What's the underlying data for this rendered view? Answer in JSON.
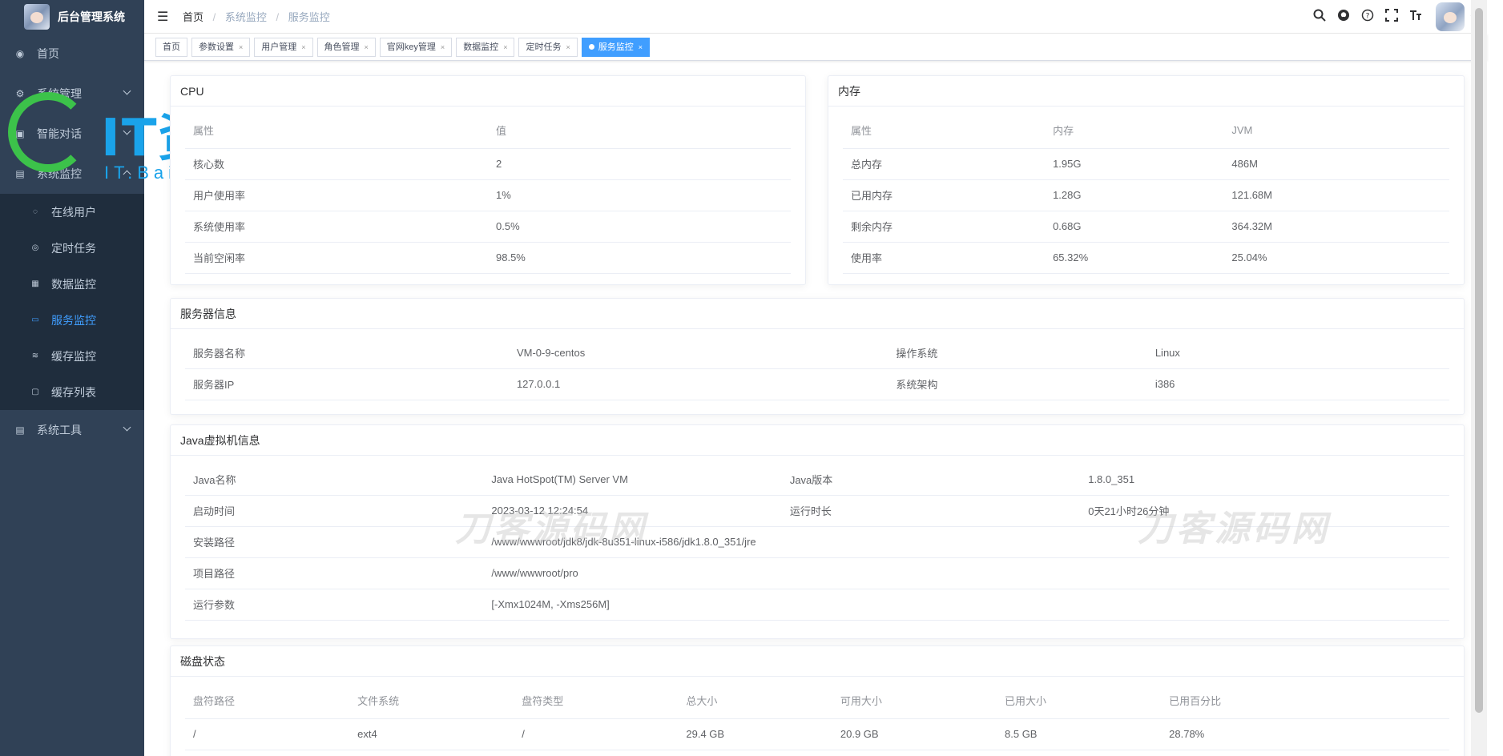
{
  "sidebar": {
    "app_title": "后台管理系统",
    "items": [
      {
        "label": "首页",
        "icon": "dashboard-icon"
      },
      {
        "label": "系统管理",
        "icon": "gear-icon"
      },
      {
        "label": "智能对话",
        "icon": "chat-icon"
      },
      {
        "label": "系统监控",
        "icon": "monitor-icon"
      }
    ],
    "sub_items": [
      {
        "label": "在线用户",
        "icon": "online-icon"
      },
      {
        "label": "定时任务",
        "icon": "job-icon"
      },
      {
        "label": "数据监控",
        "icon": "druid-icon"
      },
      {
        "label": "服务监控",
        "icon": "server-icon"
      },
      {
        "label": "缓存监控",
        "icon": "redis-icon"
      },
      {
        "label": "缓存列表",
        "icon": "redis-list-icon"
      }
    ],
    "tools": {
      "label": "系统工具",
      "icon": "tool-icon"
    }
  },
  "watermarks": {
    "logo_text": "IT资源网",
    "logo_sub": "IT.BaiDu.com",
    "dao_text": "刀客源码网"
  },
  "navbar": {
    "breadcrumb": [
      "首页",
      "系统监控",
      "服务监控"
    ],
    "icons": [
      "search-icon",
      "github-icon",
      "question-icon",
      "fullscreen-icon",
      "font-size-icon"
    ]
  },
  "tags": [
    {
      "label": "首页",
      "closable": false,
      "active": false
    },
    {
      "label": "参数设置",
      "closable": true,
      "active": false
    },
    {
      "label": "用户管理",
      "closable": true,
      "active": false
    },
    {
      "label": "角色管理",
      "closable": true,
      "active": false
    },
    {
      "label": "官网key管理",
      "closable": true,
      "active": false
    },
    {
      "label": "数据监控",
      "closable": true,
      "active": false
    },
    {
      "label": "定时任务",
      "closable": true,
      "active": false
    },
    {
      "label": "服务监控",
      "closable": true,
      "active": true
    }
  ],
  "cpu": {
    "title": "CPU",
    "headers": [
      "属性",
      "值"
    ],
    "rows": [
      [
        "核心数",
        "2"
      ],
      [
        "用户使用率",
        "1%"
      ],
      [
        "系统使用率",
        "0.5%"
      ],
      [
        "当前空闲率",
        "98.5%"
      ]
    ]
  },
  "memory": {
    "title": "内存",
    "headers": [
      "属性",
      "内存",
      "JVM"
    ],
    "rows": [
      [
        "总内存",
        "1.95G",
        "486M"
      ],
      [
        "已用内存",
        "1.28G",
        "121.68M"
      ],
      [
        "剩余内存",
        "0.68G",
        "364.32M"
      ],
      [
        "使用率",
        "65.32%",
        "25.04%"
      ]
    ]
  },
  "server": {
    "title": "服务器信息",
    "rows": [
      [
        "服务器名称",
        "VM-0-9-centos",
        "操作系统",
        "Linux"
      ],
      [
        "服务器IP",
        "127.0.0.1",
        "系统架构",
        "i386"
      ]
    ]
  },
  "jvm": {
    "title": "Java虚拟机信息",
    "rows4": [
      [
        "Java名称",
        "Java HotSpot(TM) Server VM",
        "Java版本",
        "1.8.0_351"
      ],
      [
        "启动时间",
        "2023-03-12 12:24:54",
        "运行时长",
        "0天21小时26分钟"
      ]
    ],
    "rows2": [
      [
        "安装路径",
        "/www/wwwroot/jdk8/jdk-8u351-linux-i586/jdk1.8.0_351/jre"
      ],
      [
        "项目路径",
        "/www/wwwroot/pro"
      ],
      [
        "运行参数",
        "[-Xmx1024M, -Xms256M]"
      ]
    ]
  },
  "disk": {
    "title": "磁盘状态",
    "headers": [
      "盘符路径",
      "文件系统",
      "盘符类型",
      "总大小",
      "可用大小",
      "已用大小",
      "已用百分比"
    ],
    "rows": [
      [
        "/",
        "ext4",
        "/",
        "29.4 GB",
        "20.9 GB",
        "8.5 GB",
        "28.78%"
      ]
    ]
  }
}
